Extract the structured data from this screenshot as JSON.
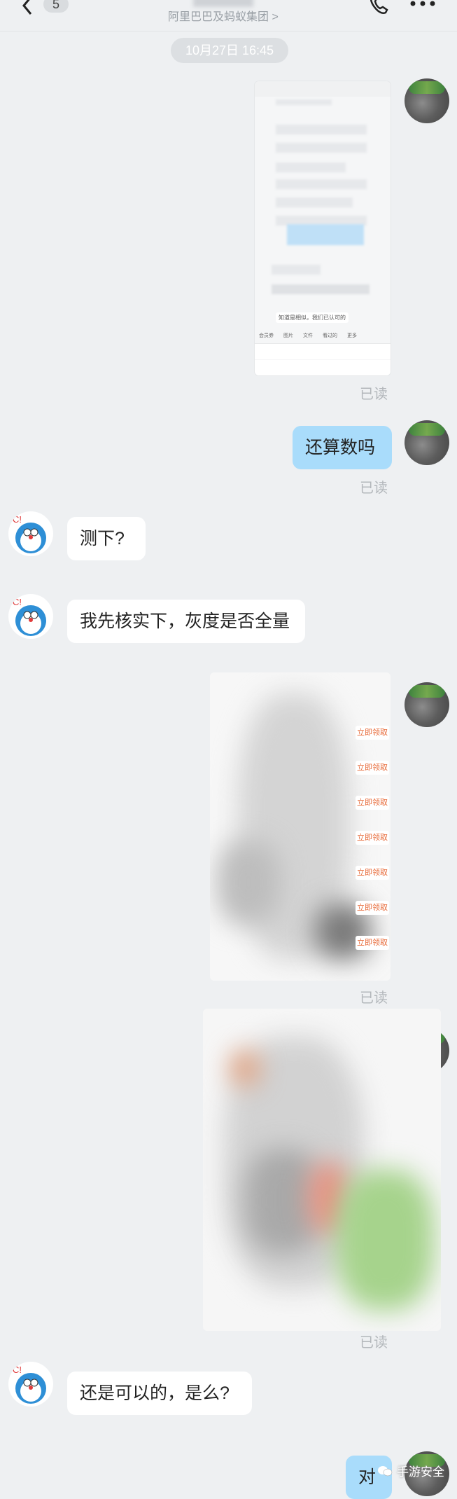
{
  "header": {
    "back_icon": "chevron-left-icon",
    "unread_count": "5",
    "subtitle": "阿里巴巴及蚂蚁集团 >",
    "phone_icon": "phone-icon",
    "more_icon": "more-icon"
  },
  "timestamp": "10月27日 16:45",
  "messages": {
    "read_label": "已读",
    "m1_text": "还算数吗",
    "m2_text": "测下?",
    "m3_text": "我先核实下，灰度是否全量",
    "m4_text": "还是可以的，是么?",
    "m5_text": "对"
  },
  "embedded_image": {
    "preview_quote": "知道是相似，我们已认可的",
    "toolbar_items": [
      "会员券",
      "图片",
      "文件",
      "看过的",
      "更多"
    ]
  },
  "claim_buttons": [
    "立即领取",
    "立即领取",
    "立即领取",
    "立即领取",
    "立即领取",
    "立即领取",
    "立即领取"
  ],
  "watermark": "手游安全",
  "colors": {
    "background": "#eef0f2",
    "outgoing_bubble": "#a9dcfb",
    "incoming_bubble": "#ffffff",
    "read_text": "#b3b7bb"
  }
}
